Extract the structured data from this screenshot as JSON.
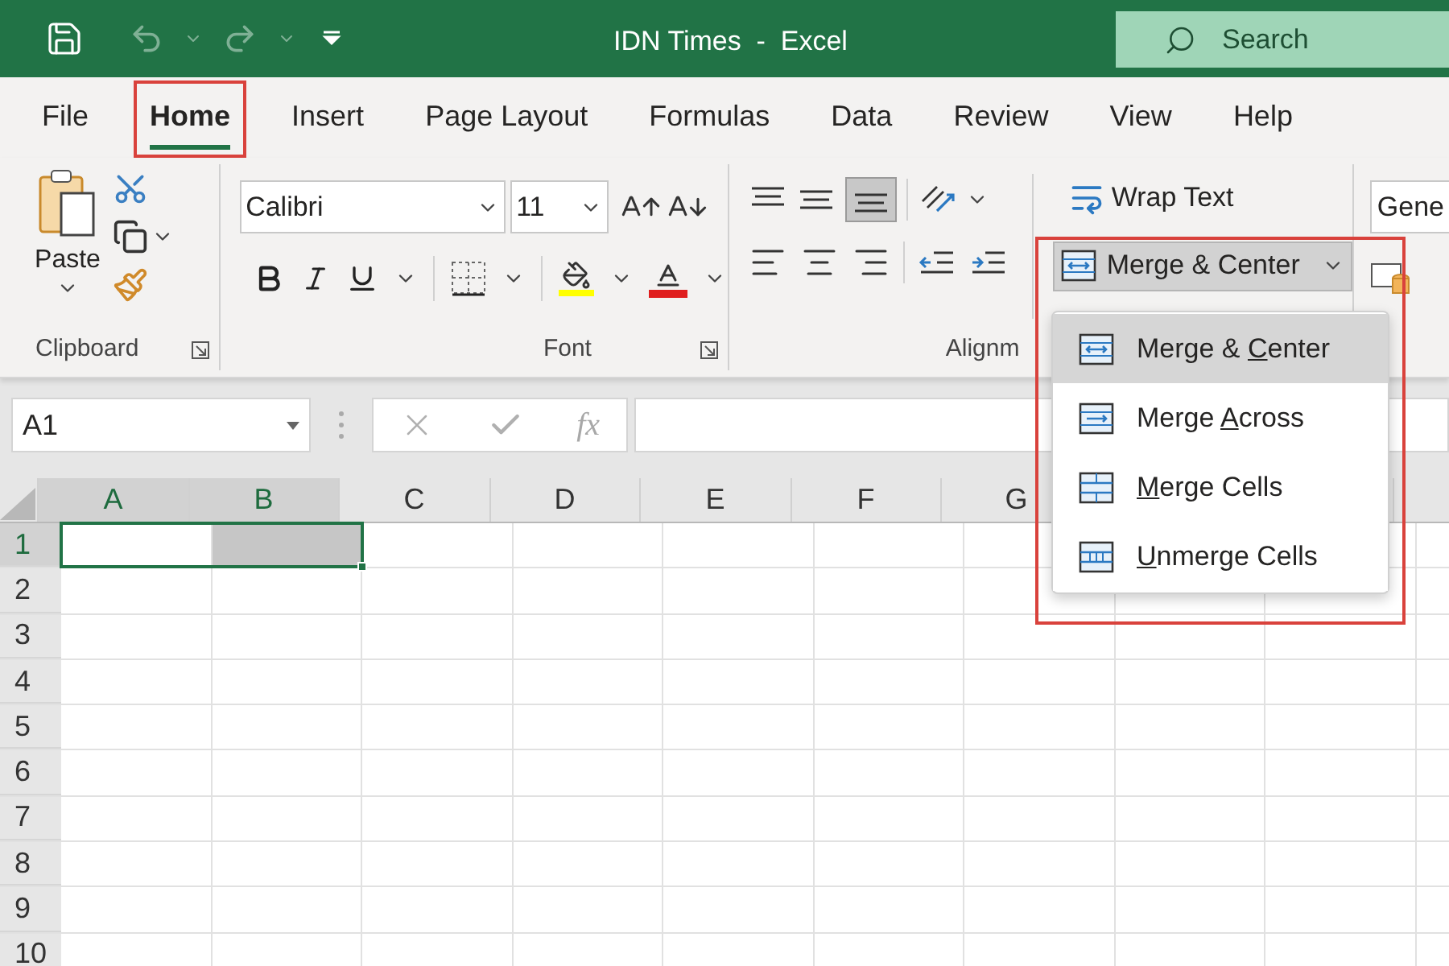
{
  "window": {
    "title": "IDN Times  -  Excel"
  },
  "search": {
    "placeholder": "Search"
  },
  "tabs": [
    {
      "label": "File",
      "selected": false
    },
    {
      "label": "Home",
      "selected": true
    },
    {
      "label": "Insert",
      "selected": false
    },
    {
      "label": "Page Layout",
      "selected": false
    },
    {
      "label": "Formulas",
      "selected": false
    },
    {
      "label": "Data",
      "selected": false
    },
    {
      "label": "Review",
      "selected": false
    },
    {
      "label": "View",
      "selected": false
    },
    {
      "label": "Help",
      "selected": false
    }
  ],
  "ribbon": {
    "clipboard": {
      "paste_label": "Paste",
      "group_label": "Clipboard"
    },
    "font": {
      "font_name": "Calibri",
      "font_size": "11",
      "group_label": "Font"
    },
    "alignment": {
      "wrap_text": "Wrap Text",
      "merge_button": "Merge & Center",
      "group_label": "Alignm",
      "expanded": true
    },
    "number": {
      "format": "Gene"
    }
  },
  "merge_menu": {
    "items": [
      {
        "kind": "center",
        "before": "Merge & ",
        "key": "C",
        "after": "enter",
        "selected": true
      },
      {
        "kind": "across",
        "before": "Merge ",
        "key": "A",
        "after": "cross",
        "selected": false
      },
      {
        "kind": "cells",
        "key": "M",
        "after": "erge Cells",
        "selected": false
      },
      {
        "kind": "unmerge",
        "key": "U",
        "after": "nmerge Cells",
        "selected": false
      }
    ]
  },
  "name_box": {
    "value": "A1"
  },
  "formula_bar": {
    "function_label": "fx"
  },
  "sheet": {
    "columns": [
      {
        "label": "A",
        "selected": true
      },
      {
        "label": "B",
        "selected": true
      },
      {
        "label": "C",
        "selected": false
      },
      {
        "label": "D",
        "selected": false
      },
      {
        "label": "E",
        "selected": false
      },
      {
        "label": "F",
        "selected": false
      },
      {
        "label": "G",
        "selected": false
      }
    ],
    "rows": [
      {
        "label": "1",
        "selected": true
      },
      {
        "label": "2",
        "selected": false
      },
      {
        "label": "3",
        "selected": false
      },
      {
        "label": "4",
        "selected": false
      },
      {
        "label": "5",
        "selected": false
      },
      {
        "label": "6",
        "selected": false
      },
      {
        "label": "7",
        "selected": false
      },
      {
        "label": "8",
        "selected": false
      },
      {
        "label": "9",
        "selected": false
      },
      {
        "label": "10",
        "selected": false
      }
    ]
  }
}
